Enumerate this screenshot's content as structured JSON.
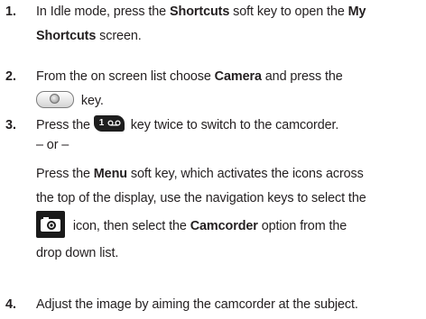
{
  "steps": [
    {
      "number": "1.",
      "l1_a": "In Idle mode, press the ",
      "l1_b": "Shortcuts",
      "l1_c": " soft key to open the ",
      "l1_d": "My",
      "l2_a": "Shortcuts",
      "l2_b": " screen."
    },
    {
      "number": "2.",
      "l1_a": "From the on screen list choose ",
      "l1_b": "Camera",
      "l1_c": " and press the",
      "key_icon": "ok-key-icon",
      "l2_a": " key."
    },
    {
      "number": "3.",
      "l1_a": "Press the ",
      "key_icon": "one-voicemail-key-icon",
      "key_text": "1",
      "l1_b": " key twice to switch to the camcorder.",
      "or": "– or –",
      "l3_a": "Press the ",
      "l3_b": "Menu",
      "l3_c": " soft key, which activates the icons across",
      "l4": "the top of the display, use the navigation keys to select the",
      "camera_icon": "camera-icon",
      "l5_a": " icon, then select the ",
      "l5_b": "Camcorder",
      "l5_c": " option from the",
      "l6": "drop down list."
    },
    {
      "number": "4.",
      "l1": "Adjust the image by aiming the camcorder at the subject."
    }
  ]
}
